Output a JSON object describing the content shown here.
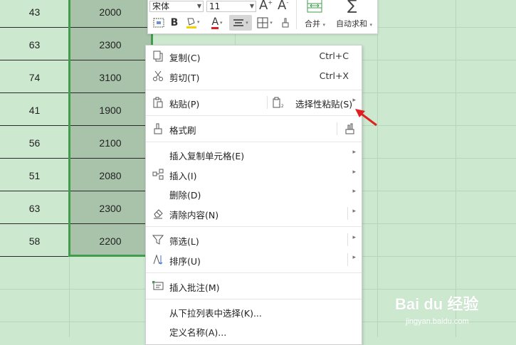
{
  "rows": [
    {
      "a": "43",
      "b": "2000"
    },
    {
      "a": "63",
      "b": "2300"
    },
    {
      "a": "74",
      "b": "3100"
    },
    {
      "a": "41",
      "b": "1900"
    },
    {
      "a": "56",
      "b": "2100"
    },
    {
      "a": "51",
      "b": "2080"
    },
    {
      "a": "63",
      "b": "2300"
    },
    {
      "a": "58",
      "b": "2200"
    }
  ],
  "toolbar": {
    "font_name": "宋体",
    "font_size": "11",
    "bold": "B",
    "font_color": "A",
    "merge_label": "合并",
    "autosum_label": "自动求和"
  },
  "menu": {
    "copy": {
      "label": "复制(C)",
      "shortcut": "Ctrl+C"
    },
    "cut": {
      "label": "剪切(T)",
      "shortcut": "Ctrl+X"
    },
    "paste": {
      "label": "粘贴(P)"
    },
    "paste_special": {
      "label": "选择性粘贴(S)"
    },
    "format_painter": {
      "label": "格式刷"
    },
    "insert_copied": {
      "label": "插入复制单元格(E)"
    },
    "insert": {
      "label": "插入(I)"
    },
    "delete": {
      "label": "删除(D)"
    },
    "clear": {
      "label": "清除内容(N)"
    },
    "filter": {
      "label": "筛选(L)"
    },
    "sort": {
      "label": "排序(U)"
    },
    "insert_comment": {
      "label": "插入批注(M)"
    },
    "pick_from_list": {
      "label": "从下拉列表中选择(K)..."
    },
    "define_name": {
      "label": "定义名称(A)..."
    }
  },
  "watermark": {
    "brand": "Bai du 经验",
    "url": "jingyan.baidu.com"
  },
  "colors": {
    "sheet_bg": "#cce8cf",
    "selection": "#a9c3ab",
    "selection_border": "#3f9d4b",
    "arrow": "#e02020"
  }
}
